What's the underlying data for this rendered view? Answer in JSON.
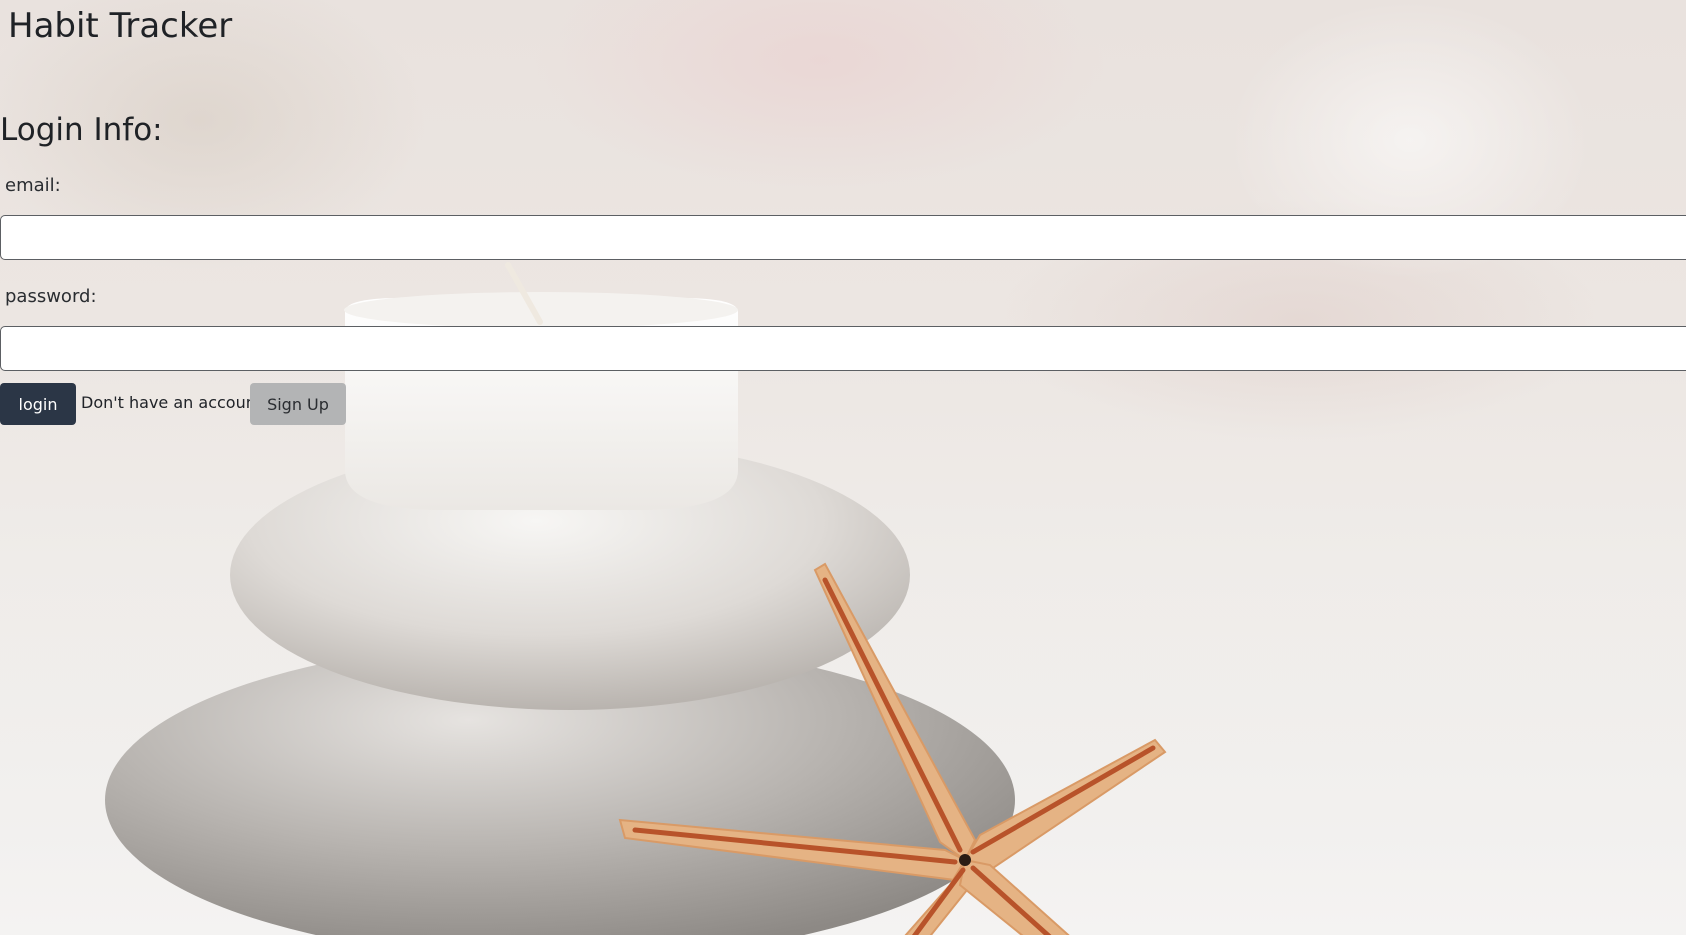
{
  "header": {
    "title": "Habit Tracker"
  },
  "login_form": {
    "heading": "Login Info:",
    "email_label": "email:",
    "email_value": "",
    "password_label": "password:",
    "password_value": "",
    "login_label": "login",
    "signup_prompt": "Don't have an account?",
    "signup_label": "Sign Up"
  },
  "colors": {
    "login_button": "#2b3646",
    "signup_button": "#b3b4b5",
    "input_background": "#ffffff"
  },
  "background": {
    "subject": "stacked-stones-candle-starfish-photo"
  }
}
